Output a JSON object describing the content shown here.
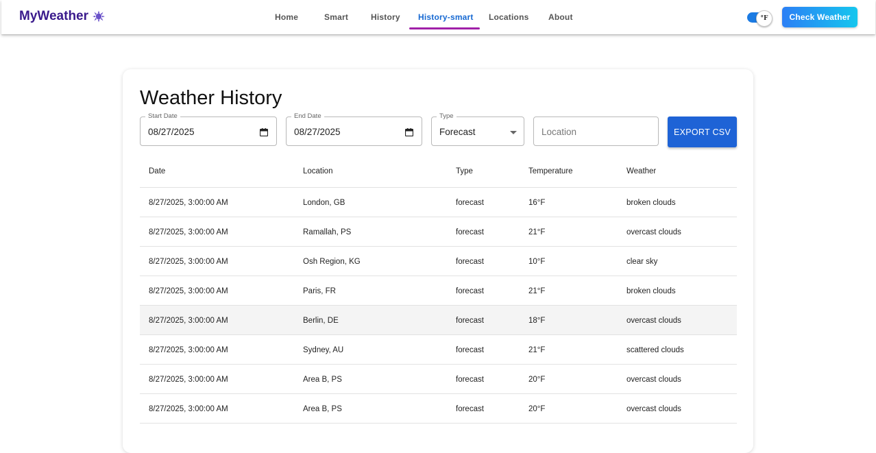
{
  "brand": {
    "name": "MyWeather",
    "icon": "weather-sun-icon"
  },
  "nav": {
    "links": [
      {
        "label": "Home"
      },
      {
        "label": "Smart"
      },
      {
        "label": "History"
      },
      {
        "label": "History-smart"
      },
      {
        "label": "Locations"
      },
      {
        "label": "About"
      }
    ],
    "active": "History-smart"
  },
  "unit_toggle": {
    "label": "°F",
    "on": true
  },
  "check_weather": {
    "label": "Check Weather"
  },
  "page": {
    "title": "Weather History"
  },
  "filters": {
    "start_date": {
      "label": "Start Date",
      "value": "08/27/2025"
    },
    "end_date": {
      "label": "End Date",
      "value": "08/27/2025"
    },
    "type": {
      "label": "Type",
      "value": "Forecast"
    },
    "location": {
      "placeholder": "Location",
      "value": ""
    },
    "export_label": "EXPORT CSV"
  },
  "table": {
    "columns": [
      "Date",
      "Location",
      "Type",
      "Temperature",
      "Weather"
    ],
    "rows": [
      {
        "date": "8/27/2025, 3:00:00 AM",
        "location": "London, GB",
        "type": "forecast",
        "temperature": "16°F",
        "weather": "broken clouds"
      },
      {
        "date": "8/27/2025, 3:00:00 AM",
        "location": "Ramallah, PS",
        "type": "forecast",
        "temperature": "21°F",
        "weather": "overcast clouds"
      },
      {
        "date": "8/27/2025, 3:00:00 AM",
        "location": "Osh Region, KG",
        "type": "forecast",
        "temperature": "10°F",
        "weather": "clear sky"
      },
      {
        "date": "8/27/2025, 3:00:00 AM",
        "location": "Paris, FR",
        "type": "forecast",
        "temperature": "21°F",
        "weather": "broken clouds"
      },
      {
        "date": "8/27/2025, 3:00:00 AM",
        "location": "Berlin, DE",
        "type": "forecast",
        "temperature": "18°F",
        "weather": "overcast clouds"
      },
      {
        "date": "8/27/2025, 3:00:00 AM",
        "location": "Sydney, AU",
        "type": "forecast",
        "temperature": "21°F",
        "weather": "scattered clouds"
      },
      {
        "date": "8/27/2025, 3:00:00 AM",
        "location": "Area B, PS",
        "type": "forecast",
        "temperature": "20°F",
        "weather": "overcast clouds"
      },
      {
        "date": "8/27/2025, 3:00:00 AM",
        "location": "Area B, PS",
        "type": "forecast",
        "temperature": "20°F",
        "weather": "overcast clouds"
      }
    ],
    "hover_row_index": 4
  },
  "colors": {
    "brand": "#3a1a8c",
    "nav_active": "#1769d2",
    "nav_underline": "#a020a8",
    "toggle_on": "#1b7be3",
    "export_button": "#1e63d6",
    "check_weather_gradient": [
      "#2c7ff5",
      "#15c6ee"
    ]
  }
}
